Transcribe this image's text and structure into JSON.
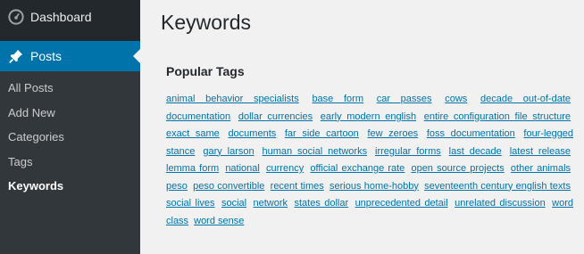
{
  "sidebar": {
    "dashboard_label": "Dashboard",
    "posts_label": "Posts",
    "submenu": [
      {
        "label": "All Posts"
      },
      {
        "label": "Add New"
      },
      {
        "label": "Categories"
      },
      {
        "label": "Tags"
      },
      {
        "label": "Keywords"
      }
    ]
  },
  "main": {
    "title": "Keywords",
    "section_heading": "Popular Tags",
    "tags": [
      "animal behavior specialists",
      "base form",
      "car passes",
      "cows",
      "decade out-of-date",
      "documentation",
      "dollar currencies",
      "early modern english",
      "entire configuration file structure",
      "exact same",
      "documents",
      "far side cartoon",
      "few zeroes",
      "foss documentation",
      "four-legged stance",
      "gary larson",
      "human social networks",
      "irregular forms",
      "last decade",
      "latest release",
      "lemma form",
      "national",
      "currency",
      "official exchange rate",
      "open source projects",
      "other animals",
      "peso",
      "peso convertible",
      "recent times",
      "serious home-hobby",
      "seventeenth century english texts",
      "social lives",
      "social",
      "network",
      "states dollar",
      "unprecedented detail",
      "unrelated discussion",
      "word class",
      "word sense"
    ]
  },
  "colors": {
    "sidebar_bg": "#23282d",
    "submenu_bg": "#32373c",
    "accent": "#0073aa",
    "page_bg": "#f1f1f1"
  },
  "icons": {
    "dashboard": "gauge-icon",
    "posts": "pushpin-icon"
  }
}
